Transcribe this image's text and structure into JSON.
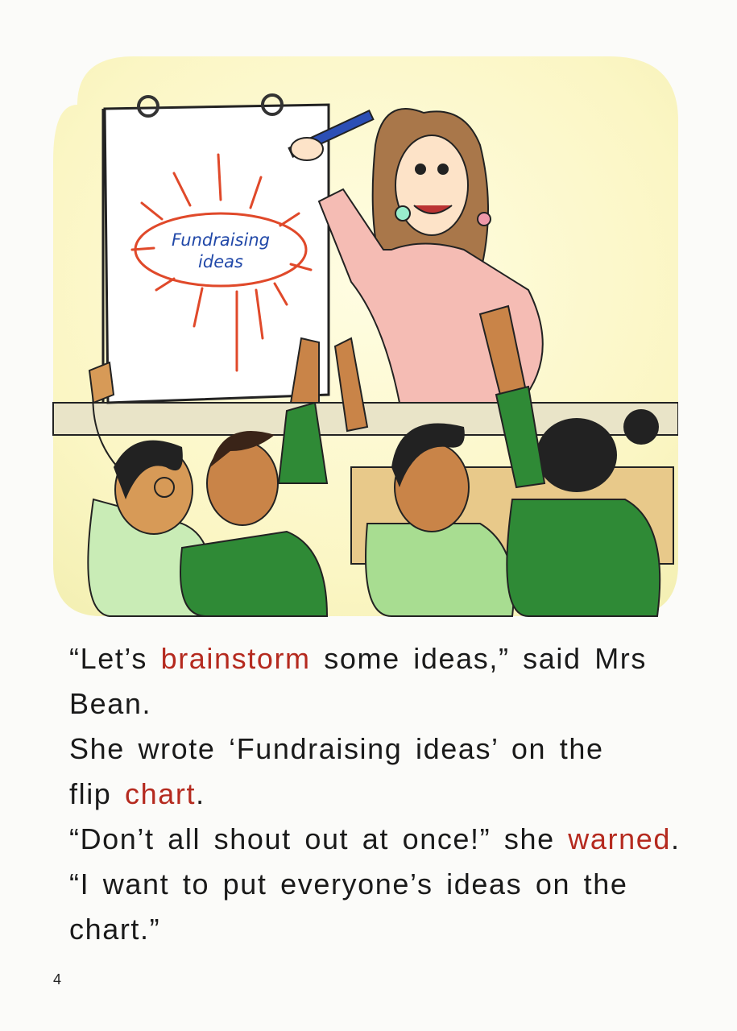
{
  "illustration": {
    "flipchart_text_line1": "Fundraising",
    "flipchart_text_line2": "ideas"
  },
  "story": {
    "line1": {
      "before": "“Let’s ",
      "highlight": "brainstorm",
      "after": " some ideas,” said Mrs"
    },
    "line2": {
      "text": "Bean."
    },
    "line3": {
      "text": "She wrote ‘Fundraising ideas’ on the"
    },
    "line4": {
      "before": "flip ",
      "highlight": "chart",
      "after": "."
    },
    "line5": {
      "before": "“Don’t all shout out at once!” she ",
      "highlight": "warned",
      "after": "."
    },
    "line6": {
      "text": "“I want to put everyone’s ideas on the"
    },
    "line7": {
      "text": "chart.”"
    }
  },
  "page_number": "4",
  "colors": {
    "highlight": "#b52a1f",
    "text": "#1a1a1a",
    "background": "#fbfbf9"
  }
}
